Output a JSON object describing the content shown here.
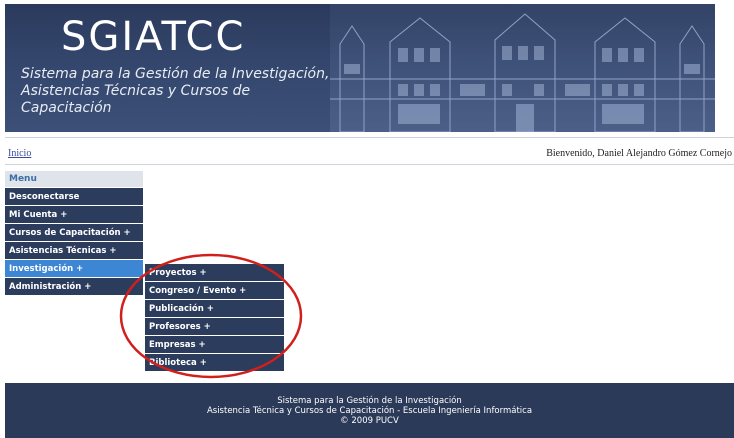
{
  "banner": {
    "logo": "SGIATCC",
    "subtitle_line1": "Sistema para la Gestión de la Investigación,",
    "subtitle_line2": "Asistencias Técnicas y Cursos de Capacitación"
  },
  "breadcrumb": {
    "home": "Inicio",
    "welcome": "Bienvenido, Daniel Alejandro Gómez Cornejo"
  },
  "menu": {
    "header": "Menu",
    "items": [
      {
        "label": "Desconectarse"
      },
      {
        "label": "Mi Cuenta +"
      },
      {
        "label": "Cursos de Capacitación +"
      },
      {
        "label": "Asistencias Técnicas +"
      },
      {
        "label": "Investigación +",
        "active": true
      },
      {
        "label": "Administración +"
      }
    ]
  },
  "submenu": {
    "items": [
      {
        "label": "Proyectos +"
      },
      {
        "label": "Congreso / Evento +"
      },
      {
        "label": "Publicación +"
      },
      {
        "label": "Profesores +"
      },
      {
        "label": "Empresas +"
      },
      {
        "label": "Biblioteca +"
      }
    ]
  },
  "footer": {
    "line1": "Sistema para la Gestión de la Investigación",
    "line2": "Asistencia Técnica y Cursos de Capacitación - Escuela Ingeniería Informática",
    "line3": "© 2009 PUCV"
  },
  "colors": {
    "menu_bg": "#2c3c5c",
    "menu_active": "#3d86d4",
    "annotation": "#d0201c"
  }
}
